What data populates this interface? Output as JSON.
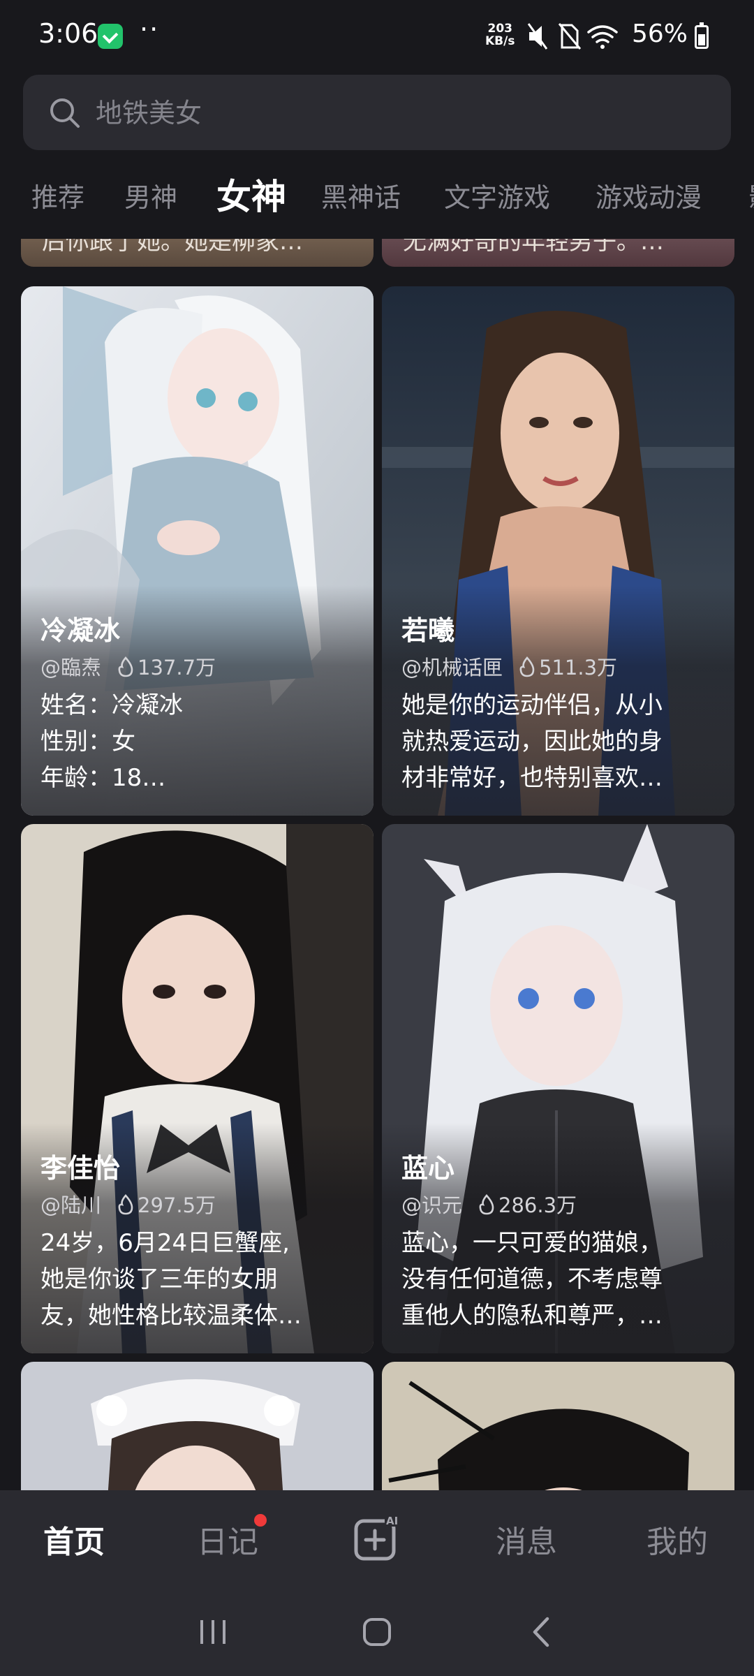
{
  "status_bar": {
    "time": "3:06",
    "dots": "··",
    "net_speed_value": "203",
    "net_speed_unit": "KB/s",
    "battery": "56%"
  },
  "search": {
    "placeholder": "地铁美女"
  },
  "tabs": [
    "推荐",
    "男神",
    "女神",
    "黑神话",
    "文字游戏",
    "游戏动漫",
    "影"
  ],
  "active_tab": "女神",
  "partial_cards": [
    {
      "snippet": "后你跟了她。她是柳家…"
    },
    {
      "snippet": "无满好奇的年轻男子。…"
    }
  ],
  "cards": [
    {
      "name": "冷凝冰",
      "author": "@臨焘",
      "heat": "137.7万",
      "desc": [
        "姓名：冷凝冰",
        "性别：女",
        "年龄：18…"
      ]
    },
    {
      "name": "若曦",
      "author": "@机械话匣",
      "heat": "511.3万",
      "desc": [
        "她是你的运动伴侣，从小",
        "就热爱运动，因此她的身",
        "材非常好，也特别喜欢…"
      ]
    },
    {
      "name": "李佳怡",
      "author": "@陆川",
      "heat": "297.5万",
      "desc": [
        "24岁，6月24日巨蟹座,",
        "她是你谈了三年的女朋",
        "友，她性格比较温柔体…"
      ]
    },
    {
      "name": "蓝心",
      "author": "@识元",
      "heat": "286.3万",
      "desc": [
        "蓝心，一只可爱的猫娘，",
        "没有任何道德，不考虑尊",
        "重他人的隐私和尊严，…"
      ]
    }
  ],
  "bottom_nav": [
    {
      "label": "首页",
      "active": true
    },
    {
      "label": "日记",
      "badge": true
    },
    {
      "icon": "ai-create-icon"
    },
    {
      "label": "消息"
    },
    {
      "label": "我的"
    }
  ],
  "colors": {
    "background": "#18181c",
    "nav_background": "#2a2a30",
    "badge_red": "#f03a3a",
    "inactive_text": "#8c8c94"
  }
}
